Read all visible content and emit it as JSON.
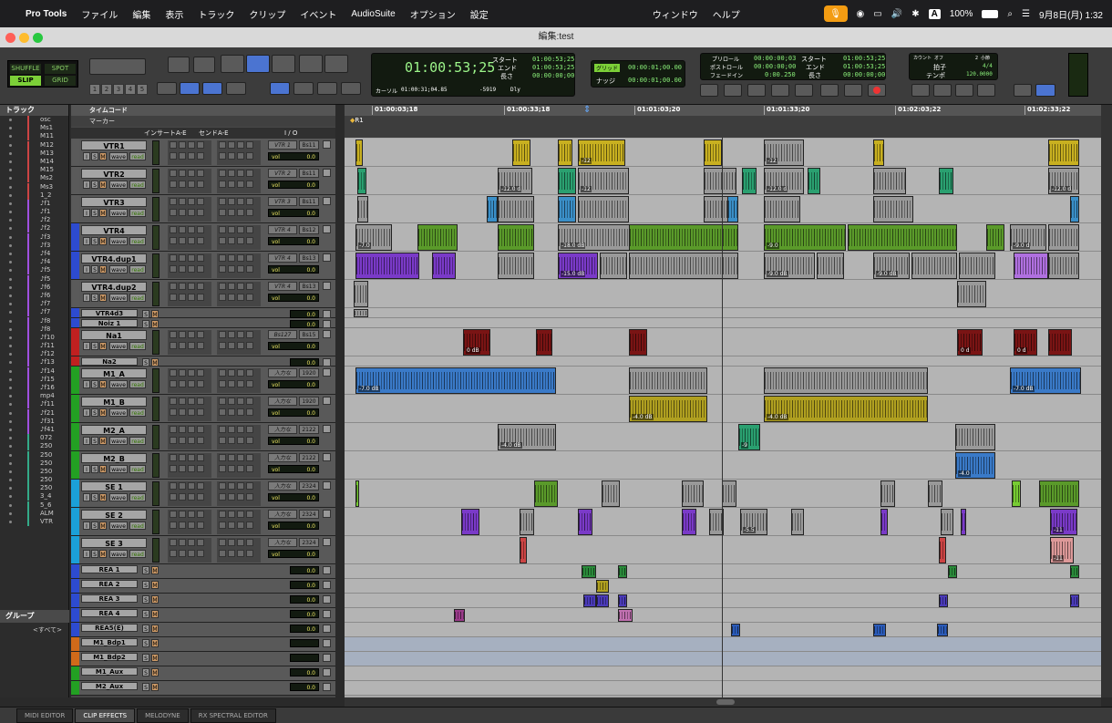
{
  "menubar": {
    "app": "Pro Tools",
    "items": [
      "ファイル",
      "編集",
      "表示",
      "トラック",
      "クリップ",
      "イベント",
      "AudioSuite",
      "オプション",
      "設定",
      "ウィンドウ",
      "ヘルプ"
    ],
    "battery": "100%",
    "datetime": "9月8日(月)  1:32",
    "input": "A"
  },
  "window": {
    "title": "編集:test"
  },
  "toolbar": {
    "modes": {
      "shuffle": "SHUFFLE",
      "spot": "SPOT",
      "slip": "SLIP",
      "grid": "GRID"
    },
    "zoom_presets": [
      "1",
      "2",
      "3",
      "4",
      "5"
    ],
    "main_counter": "01:00:53;25",
    "start_label": "スタート",
    "end_label": "エンド",
    "length_label": "長さ",
    "start": "01:00:53;25",
    "end": "01:00:53;25",
    "length": "00:00:00;00",
    "cursor_label": "カーソル",
    "cursor": "01:00:31;04.85",
    "cursor_val": "-5919",
    "grid_label": "グリッド",
    "grid": "00:00:01;00.00",
    "nudge_label": "ナッジ",
    "nudge": "00:00:01;00.00",
    "preroll_label": "プリロール",
    "preroll": "00:00:00;03",
    "postroll_label": "ポストロール",
    "postroll": "00:00:00;00",
    "fadein_label": "フェードイン",
    "fadein": "0:00.250",
    "t_start": "01:00:53;25",
    "t_end": "01:00:53;25",
    "t_length": "00:00:00;00",
    "countoff": "カウント オフ",
    "bars": "2 小節",
    "meter_label": "拍子",
    "meter": "4/4",
    "tempo_label": "テンポ",
    "tempo": "120.0000",
    "dly": "Dly"
  },
  "panels": {
    "tracks_header": "トラック",
    "groups_header": "グループ",
    "all_groups": "<すべて>"
  },
  "columns": {
    "timecode": "タイムコード",
    "marker": "マーカー",
    "inserts": "インサートA-E",
    "sends": "センドA-E",
    "io": "I / O"
  },
  "ruler": {
    "marker": "R1",
    "ticks": [
      "01:00:03;18",
      "01:00:33;18",
      "01:01:03;20",
      "01:01:33;20",
      "01:02:03;22",
      "01:02:33;22"
    ]
  },
  "track_list": [
    "osc",
    "Ms1",
    "M11",
    "M12",
    "M13",
    "M14",
    "M15",
    "Ms2",
    "Ms3",
    "1_2",
    "♪f1",
    "♪f1",
    "♪f2",
    "♪f2",
    "♪f3",
    "♪f3",
    "♪f4",
    "♪f4",
    "♪f5",
    "♪f5",
    "♪f6",
    "♪f6",
    "♪f7",
    "♪f7",
    "♪f8",
    "♪f8",
    "♪f10",
    "♪f11",
    "♪f12",
    "♪f13",
    "♪f14",
    "♪f15",
    "♪f16",
    "mp4",
    "♪f11",
    "♪f21",
    "♪f31",
    "♪f41",
    "072",
    "250",
    "250",
    "250",
    "250",
    "250",
    "250",
    "3_4",
    "5_6",
    "ALM",
    "VTR"
  ],
  "tracks": [
    {
      "name": "VTR1",
      "io": "VTR 1",
      "bus": "Bs11",
      "vol": "0.0",
      "color": "#5a5a5a"
    },
    {
      "name": "VTR2",
      "io": "VTR 2",
      "bus": "Bs11",
      "vol": "0.0",
      "color": "#5a5a5a"
    },
    {
      "name": "VTR3",
      "io": "VTR 3",
      "bus": "Bs11",
      "vol": "0.0",
      "color": "#5a5a5a"
    },
    {
      "name": "VTR4",
      "io": "VTR 4",
      "bus": "Bs12",
      "vol": "0.0",
      "color": "#2d4bd0"
    },
    {
      "name": "VTR4.dup1",
      "io": "VTR 4",
      "bus": "Bs13",
      "vol": "0.0",
      "color": "#2d4bd0"
    },
    {
      "name": "VTR4.dup2",
      "io": "VTR 4",
      "bus": "Bs13",
      "vol": "0.0",
      "color": "#5a5a5a"
    },
    {
      "name": "VTR4d3",
      "io": "",
      "bus": "",
      "vol": "0.0",
      "color": "#2d4bd0"
    },
    {
      "name": "Noiz 1",
      "io": "",
      "bus": "",
      "vol": "0.0",
      "color": "#2d4bd0"
    },
    {
      "name": "Na1",
      "io": "Bs127",
      "bus": "Bs15",
      "vol": "0.0",
      "color": "#c02020"
    },
    {
      "name": "Na2",
      "io": "",
      "bus": "",
      "vol": "0.0",
      "color": "#c02020"
    },
    {
      "name": "M1_A",
      "io": "入力な",
      "bus": "1920",
      "vol": "0.0",
      "color": "#23a023"
    },
    {
      "name": "M1_B",
      "io": "入力な",
      "bus": "1920",
      "vol": "0.0",
      "color": "#23a023"
    },
    {
      "name": "M2_A",
      "io": "入力な",
      "bus": "2122",
      "vol": "0.0",
      "color": "#23a023"
    },
    {
      "name": "M2_B",
      "io": "入力な",
      "bus": "2122",
      "vol": "0.0",
      "color": "#23a023"
    },
    {
      "name": "SE 1",
      "io": "入力な",
      "bus": "2324",
      "vol": "0.0",
      "color": "#1ba0d8"
    },
    {
      "name": "SE 2",
      "io": "入力な",
      "bus": "2324",
      "vol": "0.0",
      "color": "#1ba0d8"
    },
    {
      "name": "SE 3",
      "io": "入力な",
      "bus": "2324",
      "vol": "0.0",
      "color": "#1ba0d8"
    },
    {
      "name": "REA 1",
      "io": "",
      "bus": "",
      "vol": "0.0",
      "color": "#2d4bd0"
    },
    {
      "name": "REA 2",
      "io": "",
      "bus": "",
      "vol": "0.0",
      "color": "#2d4bd0"
    },
    {
      "name": "REA 3",
      "io": "",
      "bus": "",
      "vol": "0.0",
      "color": "#2d4bd0"
    },
    {
      "name": "REA 4",
      "io": "",
      "bus": "",
      "vol": "0.0",
      "color": "#2d4bd0"
    },
    {
      "name": "REA5(E)",
      "io": "",
      "bus": "",
      "vol": "0.0",
      "color": "#2d4bd0"
    },
    {
      "name": "M1_Bdp1",
      "io": "",
      "bus": "",
      "vol": "",
      "color": "#d06a1a"
    },
    {
      "name": "M1_Bdp2",
      "io": "",
      "bus": "",
      "vol": "",
      "color": "#d06a1a"
    },
    {
      "name": "M1_Aux",
      "io": "",
      "bus": "",
      "vol": "0.0",
      "color": "#23a023"
    },
    {
      "name": "M2_Aux",
      "io": "",
      "bus": "",
      "vol": "0.0",
      "color": "#23a023"
    }
  ],
  "clip_labels": [
    "-12",
    "-12",
    "-12.0 d",
    "-12",
    "-12.0 d",
    "-12.0 d",
    "-7.0",
    "-18.0 dB",
    "-9.0",
    "-9.0 d",
    "-15.0 dB",
    "-9.0",
    "-9.0 dB",
    "-9.0 dB",
    "0 dB",
    "0 d",
    "0 d",
    "-7.0 dB",
    "-7.0 dB",
    "-4.0 dB",
    "-4.0 dB",
    "-4.0 dB",
    "-9",
    "-4.0",
    "-5.5",
    "-11",
    "-11"
  ],
  "bottom_tabs": [
    "MIDI EDITOR",
    "CLIP EFFECTS",
    "MELODYNE",
    "RX SPECTRAL EDITOR"
  ]
}
